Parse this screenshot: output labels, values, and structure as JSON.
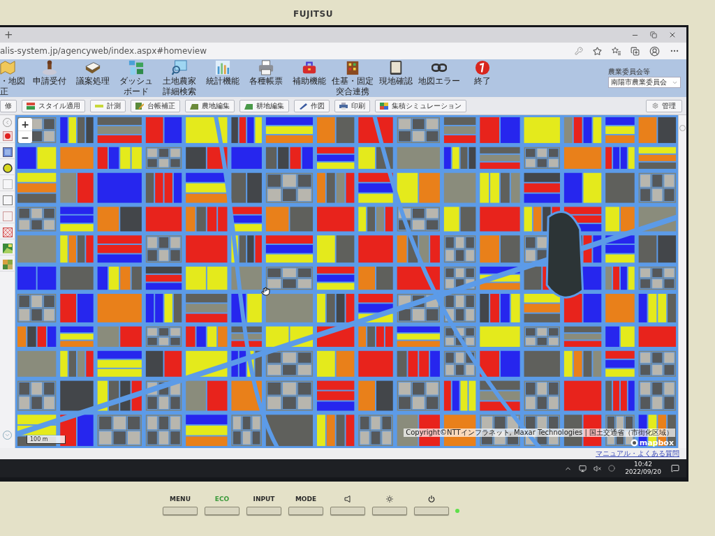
{
  "monitor": {
    "brand": "FUJITSU",
    "controls": [
      {
        "kind": "text",
        "label": "MENU"
      },
      {
        "kind": "eco",
        "label": "ECO"
      },
      {
        "kind": "text",
        "label": "INPUT"
      },
      {
        "kind": "text",
        "label": "MODE"
      },
      {
        "kind": "volume"
      },
      {
        "kind": "brightness"
      },
      {
        "kind": "power"
      }
    ],
    "power_led": {
      "on": true
    }
  },
  "browser": {
    "new_tab": "+",
    "url": "alis-system.jp/agencyweb/index.aspx#homeview"
  },
  "app_toolbar": {
    "items": [
      {
        "lines": [
          "・地図",
          "正"
        ]
      },
      {
        "lines": [
          "申請受付"
        ]
      },
      {
        "lines": [
          "議案処理"
        ]
      },
      {
        "lines": [
          "ダッシュ",
          "ボード"
        ]
      },
      {
        "lines": [
          "土地農家",
          "詳細検索"
        ]
      },
      {
        "lines": [
          "統計機能"
        ]
      },
      {
        "lines": [
          "各種帳票"
        ]
      },
      {
        "lines": [
          "補助機能"
        ]
      },
      {
        "lines": [
          "住基・固定",
          "突合連携"
        ]
      },
      {
        "lines": [
          "現地確認"
        ]
      },
      {
        "lines": [
          "地図エラー"
        ]
      },
      {
        "lines": [
          "終了"
        ]
      }
    ],
    "organization": {
      "label": "農業委員会等",
      "value": "南陽市農業委員会"
    }
  },
  "map_toolbar": {
    "buttons": [
      {
        "label": "修"
      },
      {
        "label": "スタイル適用"
      },
      {
        "label": "計測"
      },
      {
        "label": "台帳補正"
      },
      {
        "label": "農地編集"
      },
      {
        "label": "耕地編集"
      },
      {
        "label": "作図"
      },
      {
        "label": "印刷"
      },
      {
        "label": "集積シミュレーション"
      }
    ],
    "admin": {
      "label": "管理"
    }
  },
  "map": {
    "zoom_in": "+",
    "zoom_out": "−",
    "scale": "100 m",
    "attribution": "Copyright©NTTインフラネット, Maxar Technologies | 国土交通省（市街化区域）",
    "logo": "mapbox"
  },
  "footer": {
    "link": "マニュアル・よくある質問"
  },
  "taskbar": {
    "time": "10:42",
    "date": "2022/09/20"
  }
}
